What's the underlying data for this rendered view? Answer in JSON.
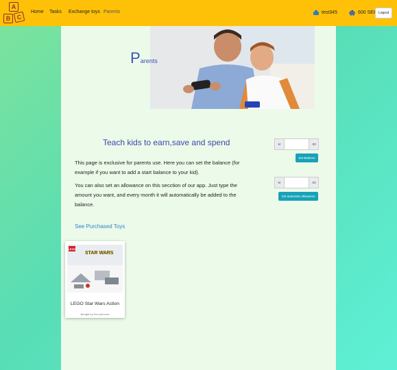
{
  "nav": {
    "logo_letters": [
      "A",
      "B",
      "C"
    ],
    "items": [
      {
        "label": "Home"
      },
      {
        "label": "Tasks"
      },
      {
        "label": "Exchange toys"
      },
      {
        "label": "Parents"
      }
    ],
    "active": "Parents",
    "username": "test345",
    "balance": "600 SEK",
    "logout_label": "Logout"
  },
  "hero": {
    "title_initial": "P",
    "title_rest": "arents"
  },
  "content": {
    "heading": "Teach kids to earn,save and spend",
    "paragraph1": "This page is exclusive for parents use. Here you can set the balance (for example if you want to add a start balance to your kid).",
    "paragraph2": "You can also set an allowance on this secction of our app. Just type the amount you want, and every month it will automatically be added to the balance.",
    "purchased_link": "See Purchased Toys"
  },
  "balance_form": {
    "prefix": "kr",
    "suffix": ".00",
    "value": "",
    "button_label": "Set Balance"
  },
  "allowance_form": {
    "prefix": "kr",
    "suffix": ".00",
    "value": "",
    "button_label": "Set automatic allowance"
  },
  "purchased_toys": [
    {
      "title": "LEGO Star Wars Action",
      "subtitle": "Bought by Kes just now",
      "box_text": "STAR WARS",
      "brand": "LEGO"
    }
  ],
  "colors": {
    "topbar": "#ffc107",
    "heading": "#3a46a8",
    "link": "#2c82c9",
    "button": "#17a2b8"
  }
}
